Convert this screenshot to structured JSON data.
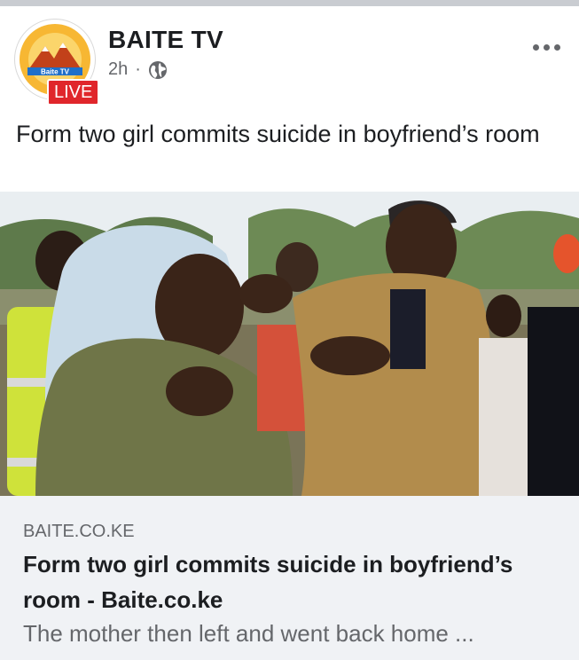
{
  "page": {
    "name": "BAITE TV",
    "live_label": "LIVE",
    "logo_text": "Baite TV",
    "time": "2h",
    "separator": "·",
    "privacy_icon": "globe-icon",
    "more_icon": "more-options-icon"
  },
  "post": {
    "text": "Form two girl commits suicide in boyfriend’s room"
  },
  "link": {
    "domain": "BAITE.CO.KE",
    "title": "Form two girl commits suicide in boyfriend’s room - Baite.co.ke",
    "description": "The mother then left and went back home ..."
  },
  "colors": {
    "live_red": "#e0262b",
    "logo_orange": "#f5a623",
    "text_secondary": "#65676b",
    "preview_bg": "#f0f2f5"
  }
}
